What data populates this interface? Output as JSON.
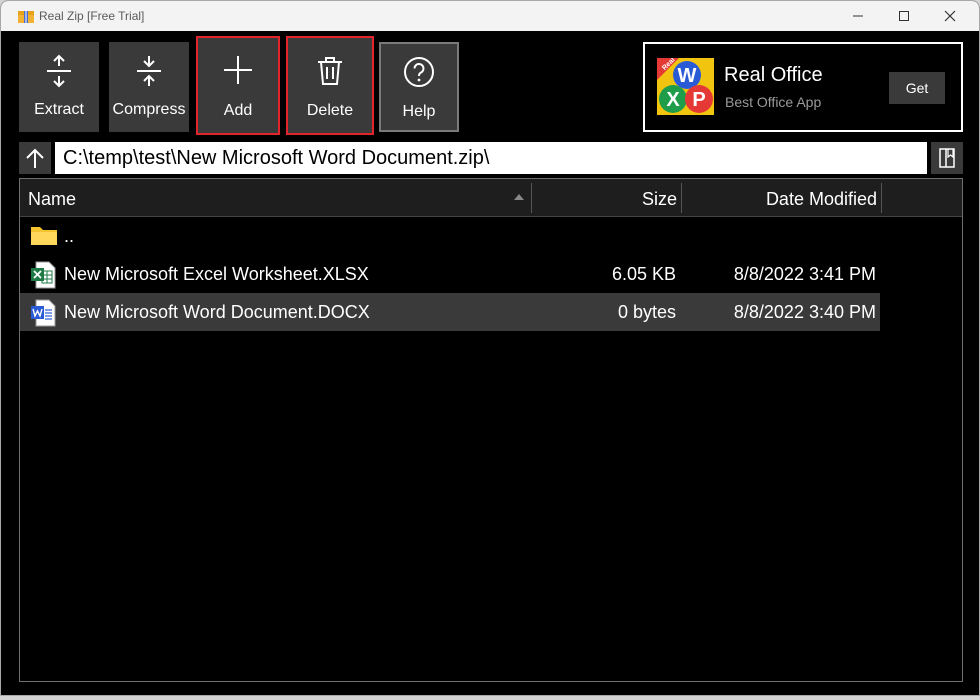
{
  "window": {
    "title": "Real Zip [Free Trial]"
  },
  "toolbar": {
    "buttons": [
      {
        "label": "Extract",
        "icon": "extract-icon",
        "highlighted": false
      },
      {
        "label": "Compress",
        "icon": "compress-icon",
        "highlighted": false
      },
      {
        "label": "Add",
        "icon": "plus-icon",
        "highlighted": true
      },
      {
        "label": "Delete",
        "icon": "trash-icon",
        "highlighted": true
      },
      {
        "label": "Help",
        "icon": "help-icon",
        "highlighted": false
      }
    ]
  },
  "ad": {
    "title": "Real Office",
    "subtitle": "Best Office App",
    "get_label": "Get",
    "logo_badge": "Real",
    "logo_letters": [
      "W",
      "X",
      "P"
    ]
  },
  "address": {
    "path": "C:\\temp\\test\\New Microsoft Word Document.zip\\"
  },
  "list": {
    "columns": {
      "name": "Name",
      "size": "Size",
      "date": "Date Modified"
    },
    "rows": [
      {
        "icon": "folder-icon",
        "name": "..",
        "size": "",
        "date": "",
        "selected": false
      },
      {
        "icon": "excel-file-icon",
        "name": "New Microsoft Excel Worksheet.XLSX",
        "size": "6.05 KB",
        "date": "8/8/2022 3:41 PM",
        "selected": false
      },
      {
        "icon": "word-file-icon",
        "name": "New Microsoft Word Document.DOCX",
        "size": "0 bytes",
        "date": "8/8/2022 3:40 PM",
        "selected": true
      }
    ]
  },
  "colors": {
    "highlight_border": "#e0262a",
    "button_bg": "#3a3a3a",
    "background": "#000000",
    "selected_row": "#3a3a3a"
  }
}
